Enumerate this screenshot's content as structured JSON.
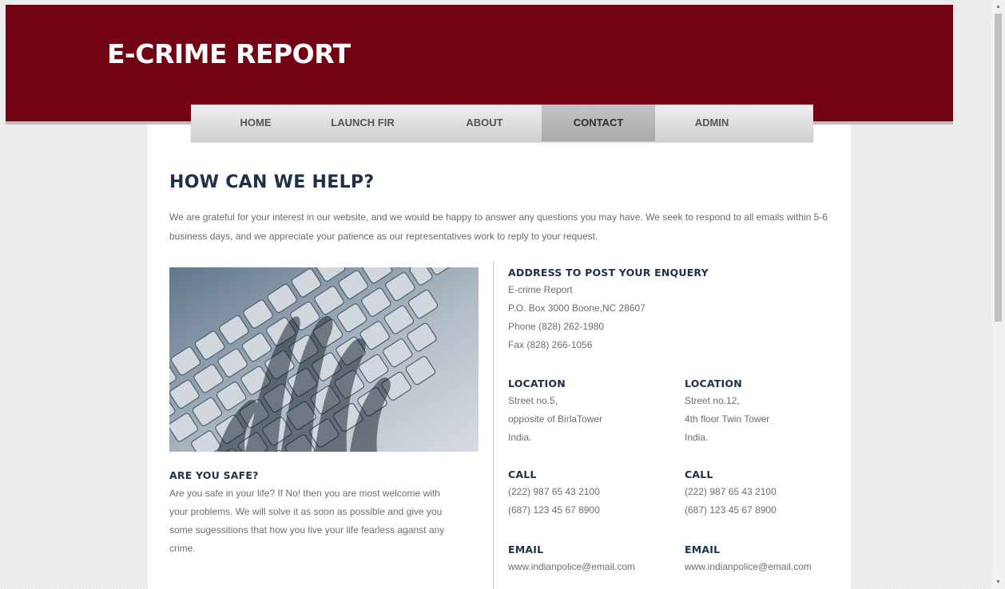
{
  "header": {
    "logo": "E-CRIME REPORT"
  },
  "nav": [
    "HOME",
    "LAUNCH FIR",
    "ABOUT",
    "CONTACT",
    "ADMIN"
  ],
  "main": {
    "title": "HOW CAN WE HELP?",
    "intro": "We are grateful for your interest in our website, and we would be happy to answer any questions you may have. We seek to respond to all emails within 5-6 business days, and we appreciate your patience as our representatives work to reply to your request."
  },
  "safe": {
    "title": "ARE YOU SAFE?",
    "lines": [
      "Are you safe in your life? If No! then you are most welcome with",
      "your problems. We will solve it as soon as possible and give you",
      "some sugessitions that how you live your life fearless aganst any",
      "crime."
    ]
  },
  "address": {
    "title": "ADDRESS TO POST YOUR ENQUERY",
    "lines": [
      "E-crime Report",
      "P.O. Box 3000 Boone,NC 28607",
      "Phone (828) 262-1980",
      "Fax (828) 266-1056"
    ]
  },
  "locations": [
    {
      "location_title": "LOCATION",
      "location_lines": [
        "Street no.5,",
        "opposite of BirlaTower",
        "India."
      ],
      "call_title": "CALL",
      "call_lines": [
        "(222) 987 65 43 2100",
        "(687) 123 45 67 8900"
      ],
      "email_title": "EMAIL",
      "email": "www.indianpolice@email.com"
    },
    {
      "location_title": "LOCATION",
      "location_lines": [
        "Street no.12,",
        "4th floor Twin Tower",
        "India."
      ],
      "call_title": "CALL",
      "call_lines": [
        "(222) 987 65 43 2100",
        "(687) 123 45 67 8900"
      ],
      "email_title": "EMAIL",
      "email": "www.indianpolice@email.com"
    }
  ],
  "colors": {
    "header": "#710010",
    "heading": "#1f3049",
    "divider": "#e2c27c",
    "active_tab": "#b0b0b0"
  },
  "icons": {
    "scroll_up": "triangle-up",
    "scroll_down": "triangle-down"
  }
}
